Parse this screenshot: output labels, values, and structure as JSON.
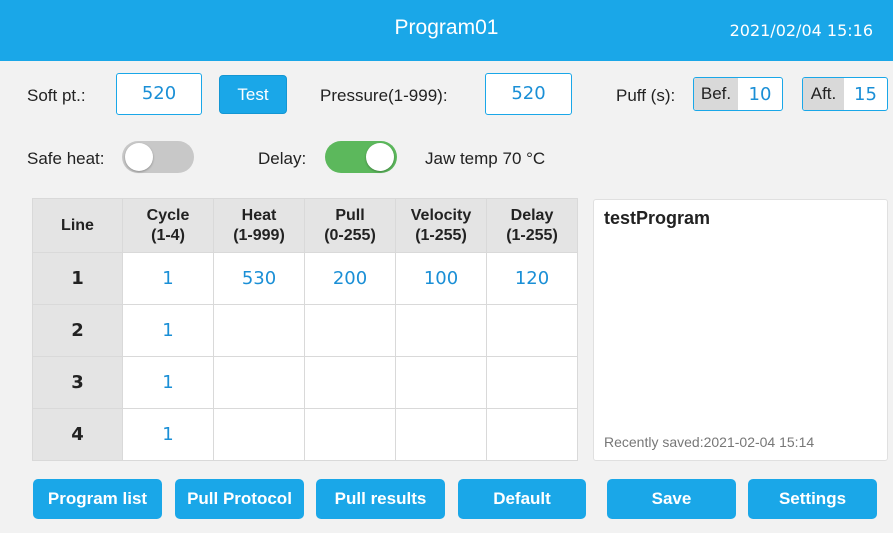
{
  "header": {
    "title": "Program01",
    "datetime": "2021/02/04  15:16"
  },
  "params": {
    "soft_pt_label": "Soft pt.:",
    "soft_pt_value": "520",
    "test_button": "Test",
    "pressure_label": "Pressure(1-999):",
    "pressure_value": "520",
    "puff_label": "Puff (s):",
    "puff_bef_label": "Bef.",
    "puff_bef_value": "10",
    "puff_aft_label": "Aft.",
    "puff_aft_value": "15",
    "safe_heat_label": "Safe heat:",
    "safe_heat_on": false,
    "delay_label": "Delay:",
    "delay_on": true,
    "jaw_temp_label": "Jaw temp",
    "jaw_temp_value": "70 °C"
  },
  "table": {
    "headers": [
      {
        "line1": "Line",
        "line2": ""
      },
      {
        "line1": "Cycle",
        "line2": "(1-4)"
      },
      {
        "line1": "Heat",
        "line2": "(1-999)"
      },
      {
        "line1": "Pull",
        "line2": "(0-255)"
      },
      {
        "line1": "Velocity",
        "line2": "(1-255)"
      },
      {
        "line1": "Delay",
        "line2": "(1-255)"
      }
    ],
    "rows": [
      [
        "1",
        "1",
        "530",
        "200",
        "100",
        "120"
      ],
      [
        "2",
        "1",
        "",
        "",
        "",
        ""
      ],
      [
        "3",
        "1",
        "",
        "",
        "",
        ""
      ],
      [
        "4",
        "1",
        "",
        "",
        "",
        ""
      ]
    ]
  },
  "notes": {
    "program_name": "testProgram",
    "recently_saved": "Recently saved:2021-02-04 15:14"
  },
  "buttons": {
    "program_list": "Program list",
    "pull_protocol": "Pull Protocol",
    "pull_results": "Pull results",
    "default": "Default",
    "save": "Save",
    "settings": "Settings"
  },
  "colors": {
    "accent": "#1aa7e8",
    "value_text": "#1a8fd6",
    "toggle_on": "#5cb85c",
    "toggle_off": "#c8c8c8"
  }
}
